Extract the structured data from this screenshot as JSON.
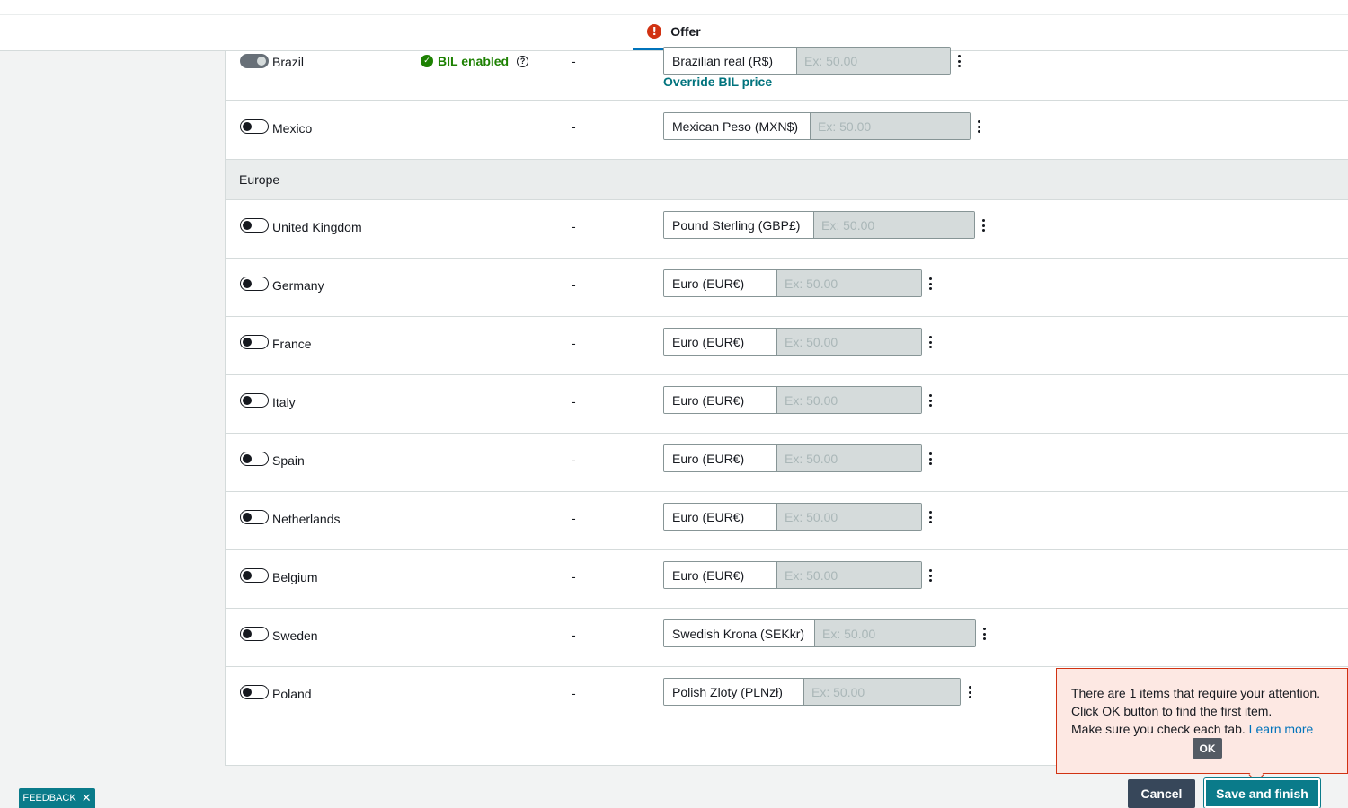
{
  "header": {
    "tab_label": "Offer",
    "tab_error_glyph": "!"
  },
  "colors": {
    "accent_teal": "#0a7b8a",
    "error_red": "#d13212",
    "success_green": "#1d8102",
    "link_blue": "#0073bb"
  },
  "regions": {
    "europe_label": "Europe"
  },
  "rows": [
    {
      "country": "Brazil",
      "enabled": true,
      "bil_label": "BIL enabled",
      "dash": "-",
      "currency": "Brazilian real (R$)",
      "placeholder": "Ex: 50.00",
      "override_link": "Override BIL price"
    },
    {
      "country": "Mexico",
      "enabled": false,
      "dash": "-",
      "currency": "Mexican Peso (MXN$)",
      "placeholder": "Ex: 50.00"
    },
    {
      "country": "United Kingdom",
      "enabled": false,
      "dash": "-",
      "currency": "Pound Sterling (GBP£)",
      "placeholder": "Ex: 50.00"
    },
    {
      "country": "Germany",
      "enabled": false,
      "dash": "-",
      "currency": "Euro (EUR€)",
      "placeholder": "Ex: 50.00"
    },
    {
      "country": "France",
      "enabled": false,
      "dash": "-",
      "currency": "Euro (EUR€)",
      "placeholder": "Ex: 50.00"
    },
    {
      "country": "Italy",
      "enabled": false,
      "dash": "-",
      "currency": "Euro (EUR€)",
      "placeholder": "Ex: 50.00"
    },
    {
      "country": "Spain",
      "enabled": false,
      "dash": "-",
      "currency": "Euro (EUR€)",
      "placeholder": "Ex: 50.00"
    },
    {
      "country": "Netherlands",
      "enabled": false,
      "dash": "-",
      "currency": "Euro (EUR€)",
      "placeholder": "Ex: 50.00"
    },
    {
      "country": "Belgium",
      "enabled": false,
      "dash": "-",
      "currency": "Euro (EUR€)",
      "placeholder": "Ex: 50.00"
    },
    {
      "country": "Sweden",
      "enabled": false,
      "dash": "-",
      "currency": "Swedish Krona (SEKkr)",
      "placeholder": "Ex: 50.00"
    },
    {
      "country": "Poland",
      "enabled": false,
      "dash": "-",
      "currency": "Polish Zloty (PLNzł)",
      "placeholder": "Ex: 50.00"
    }
  ],
  "feedback": {
    "label": "FEEDBACK",
    "close_glyph": "✕"
  },
  "alert": {
    "line1": "There are 1 items that require your attention.",
    "line2": "Click OK button to find the first item.",
    "line3": "Make sure you check each tab.",
    "learn_more": "Learn more",
    "ok_label": "OK"
  },
  "footer": {
    "cancel_label": "Cancel",
    "save_label": "Save and finish"
  }
}
